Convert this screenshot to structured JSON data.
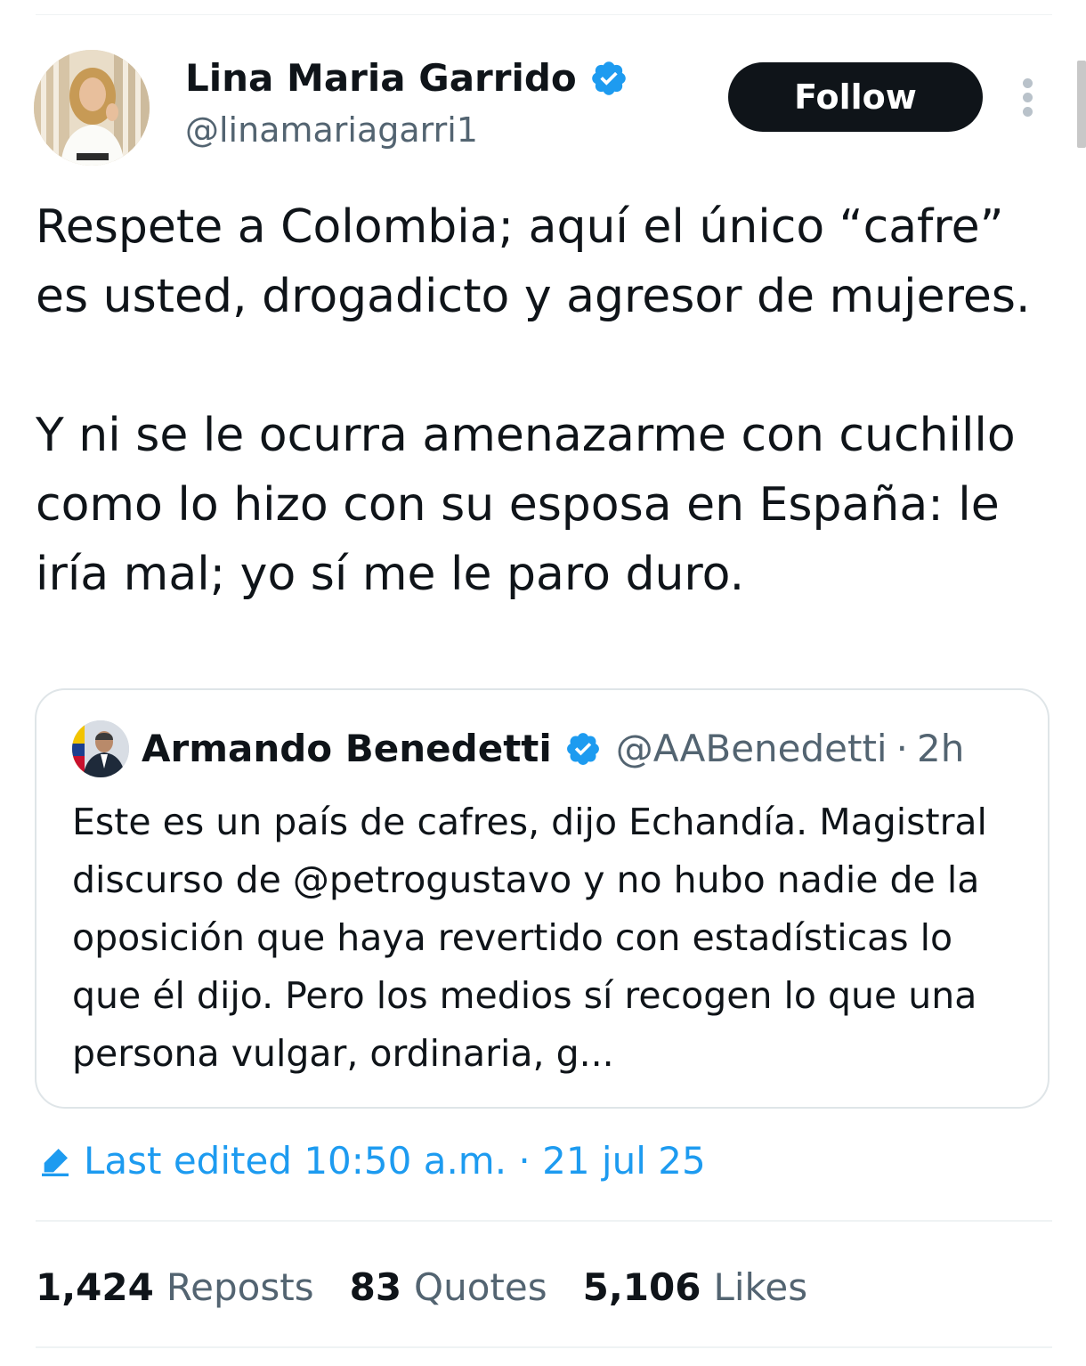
{
  "colors": {
    "text_primary": "#0f1419",
    "text_secondary": "#536471",
    "accent": "#1d9bf0",
    "follow_button_bg": "#0f1419",
    "follow_button_text": "#ffffff",
    "border": "#dfe5e8"
  },
  "author": {
    "name": "Lina Maria Garrido",
    "handle": "@linamariagarri1",
    "verified": true,
    "verified_icon": "verified-badge-icon"
  },
  "header": {
    "follow_label": "Follow",
    "more_icon": "more-vertical-icon"
  },
  "tweet": {
    "paragraphs": [
      "Respete a Colombia; aquí el único “cafre” es usted, drogadicto y agresor de mujeres.",
      "Y ni se le ocurra amenazarme con cuchillo como lo hizo con su esposa en España: le iría mal; yo sí me le paro duro."
    ]
  },
  "quote": {
    "name": "Armando Benedetti",
    "verified": true,
    "handle": "@AABenedetti",
    "separator": "·",
    "time": "2h",
    "text": "Este es un país de cafres, dijo Echandía. Magistral discurso de @petrogustavo y no hubo nadie de la oposición que haya revertido con estadísticas lo que él dijo. Pero los medios sí recogen lo que una persona vulgar, ordinaria, g..."
  },
  "edited": {
    "icon": "pencil-edit-icon",
    "label": "Last edited 10:50 a.m. · 21 jul 25"
  },
  "stats": {
    "reposts_count": "1,424",
    "reposts_label": "Reposts",
    "quotes_count": "83",
    "quotes_label": "Quotes",
    "likes_count": "5,106",
    "likes_label": "Likes"
  }
}
